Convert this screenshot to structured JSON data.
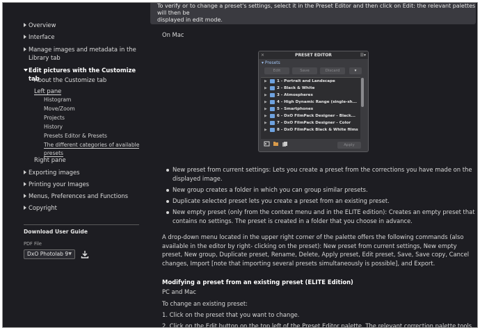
{
  "sidebar": {
    "items": [
      {
        "label": "Overview"
      },
      {
        "label": "Interface"
      },
      {
        "label": "Manage images and metadata in the"
      },
      {
        "label": "Library tab"
      },
      {
        "label": "Edit pictures with the Customize tab"
      },
      {
        "label": "About the Customize tab"
      },
      {
        "label": "Left pane"
      },
      {
        "label": "Histogram"
      },
      {
        "label": "Move/Zoom"
      },
      {
        "label": "Projects"
      },
      {
        "label": "History"
      },
      {
        "label": "Presets Editor & Presets"
      },
      {
        "label": "The different categories of available"
      },
      {
        "label": "presets"
      },
      {
        "label": "Right pane"
      },
      {
        "label": "Exporting images"
      },
      {
        "label": "Printing your Images"
      },
      {
        "label": "Menus, Preferences and Functions"
      },
      {
        "label": "Copyright"
      }
    ],
    "download_title": "Download User Guide",
    "pdf_label": "PDF File",
    "pdf_selected": "DxO Photolab 9"
  },
  "main": {
    "banner_line1": "To verify or to change a preset's settings, select it in the Preset Editor and then click on Edit: the relevant palettes will then be",
    "banner_line2": "displayed in edit mode.",
    "on_mac": "On Mac",
    "preset_editor": {
      "title": "PRESET EDITOR",
      "section": "Presets",
      "edit": "Edit",
      "save": "Save",
      "discard": "Discard",
      "apply": "Apply",
      "rows": [
        "1 - Portrait and Landscape",
        "2 - Black & White",
        "3 - Atmospheres",
        "4 - High Dynamic Range (single-sh...",
        "5 - Smartphones",
        "6 - DxO FilmPack Designer - Black...",
        "7 - DxO FilmPack Designer - Color",
        "8 - DxO FilmPack Black & White films"
      ]
    },
    "bullets": [
      [
        "New preset from current settings: Lets you create a preset from the corrections you have made on the",
        "displayed image."
      ],
      [
        "New group creates a folder in which you can group similar presets."
      ],
      [
        "Duplicate selected preset lets you create a preset from an existing preset."
      ],
      [
        "New empty preset (only from the context menu and in the ELITE edition): Creates an empty preset that",
        "contains no settings. The preset is created in a folder that you choose in advance."
      ]
    ],
    "paragraph": [
      "A drop-down menu located in the upper right corner of the palette offers the following commands (also",
      "available in the editor by right- clicking on the preset): New preset from current settings, New empty",
      "preset, New group, Duplicate preset, Rename, Delete, Apply preset, Edit preset, Save, Save copy, Cancel",
      "changes, Import [note that importing several presets simultaneously is possible], and Export."
    ],
    "heading": "Modifying a preset from an existing preset (ELITE Edition)",
    "pc_mac": "PC and Mac",
    "to_change": "To change an existing preset:",
    "step1": "1. Click on the preset that you want to change.",
    "step2": "2. Click on the Edit button on the top left of the Preset Editor palette. The relevant correction palette tools"
  }
}
